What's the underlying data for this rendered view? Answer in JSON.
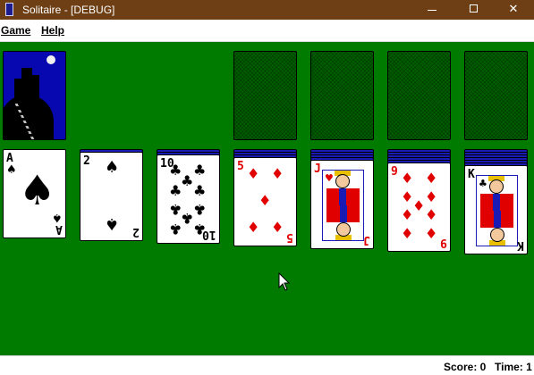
{
  "window": {
    "title": "Solitaire - [DEBUG]"
  },
  "window_controls": {
    "minimize": "minimize",
    "maximize": "maximize",
    "close": "✕"
  },
  "menu": {
    "items": [
      "Game",
      "Help"
    ]
  },
  "stock": {
    "card_back": "castle-design"
  },
  "foundations": {
    "count": 4,
    "state": "empty"
  },
  "tableau": [
    {
      "rank": "A",
      "suit": "♠",
      "color": "black",
      "hidden_cards": 0
    },
    {
      "rank": "2",
      "suit": "♠",
      "color": "black",
      "hidden_cards": 1
    },
    {
      "rank": "10",
      "suit": "♣",
      "color": "black",
      "hidden_cards": 2
    },
    {
      "rank": "5",
      "suit": "♦",
      "color": "red",
      "hidden_cards": 3
    },
    {
      "rank": "J",
      "suit": "♥",
      "color": "red",
      "hidden_cards": 4
    },
    {
      "rank": "9",
      "suit": "♦",
      "color": "red",
      "hidden_cards": 5
    },
    {
      "rank": "K",
      "suit": "♣",
      "color": "black",
      "hidden_cards": 6
    }
  ],
  "status": {
    "score": "Score: 0",
    "time": "Time: 1"
  },
  "colors": {
    "felt": "#007b00",
    "titlebar": "#6e3f15",
    "card_back": "#1a1ab4",
    "red_suit": "#e00000"
  }
}
